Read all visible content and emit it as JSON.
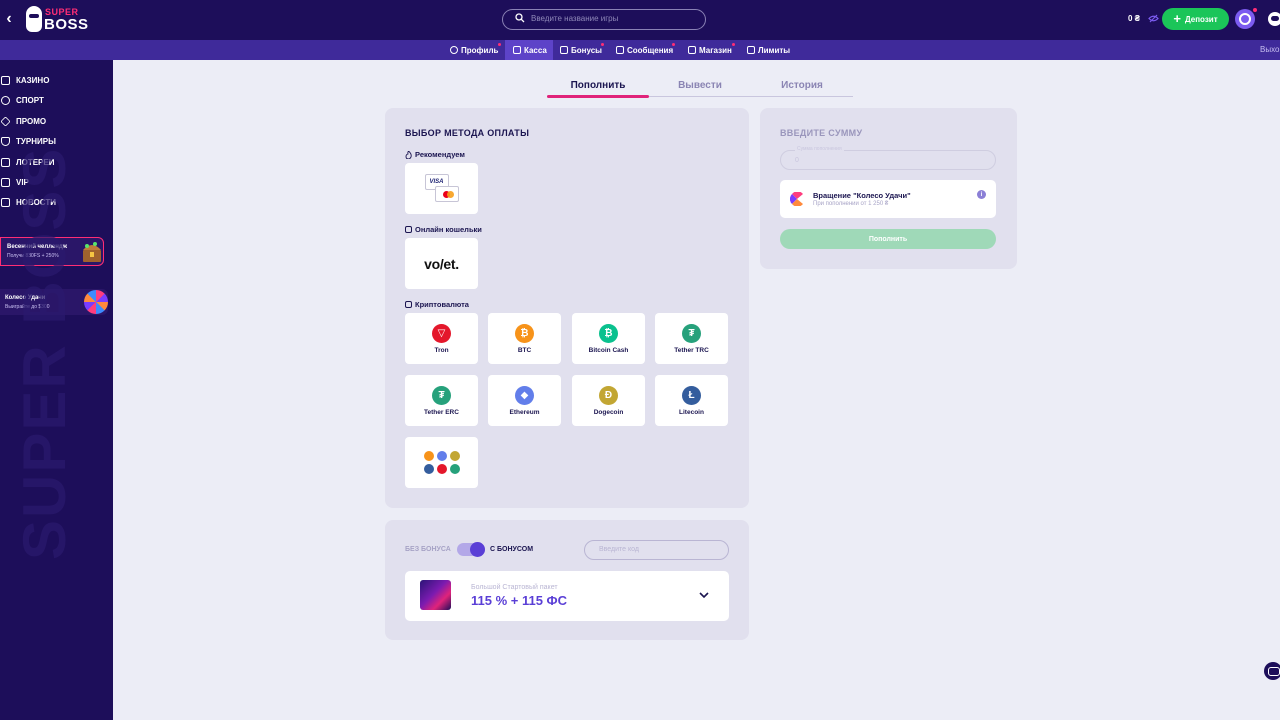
{
  "header": {
    "logo_top": "SUPER",
    "logo_bottom": "BOSS",
    "search_placeholder": "Введите название игры",
    "balance": "0 ₴",
    "deposit_label": "Депозит"
  },
  "subnav": {
    "items": [
      {
        "label": "Профиль",
        "icon": "user-icon"
      },
      {
        "label": "Касса",
        "icon": "wallet-icon",
        "active": true
      },
      {
        "label": "Бонусы",
        "icon": "gift-icon"
      },
      {
        "label": "Сообщения",
        "icon": "message-icon"
      },
      {
        "label": "Магазин",
        "icon": "shop-icon"
      },
      {
        "label": "Лимиты",
        "icon": "sliders-icon"
      }
    ],
    "logout": "Выхо"
  },
  "sidebar": {
    "items": [
      {
        "label": "КАЗИНО",
        "icon": "casino-icon"
      },
      {
        "label": "СПОРТ",
        "icon": "sport-icon"
      },
      {
        "label": "ПРОМО",
        "icon": "diamond-icon"
      },
      {
        "label": "ТУРНИРЫ",
        "icon": "trophy-icon"
      },
      {
        "label": "ЛОТЕРЕИ",
        "icon": "ticket-icon"
      },
      {
        "label": "VIP",
        "icon": "crown-icon"
      },
      {
        "label": "НОВОСТИ",
        "icon": "news-icon"
      }
    ],
    "promo1": {
      "title": "Весенний челлендж",
      "subtitle": "Получи 830FS + 250%"
    },
    "promo2": {
      "title": "Колесо Удачи",
      "subtitle": "Выиграйте до $300"
    },
    "bg_text": "SUPER BOSS"
  },
  "tabs": [
    {
      "label": "Пополнить",
      "active": true
    },
    {
      "label": "Вывести"
    },
    {
      "label": "История"
    }
  ],
  "methods": {
    "title": "ВЫБОР МЕТОДА ОПЛАТЫ",
    "sections": {
      "recommended": "Рекомендуем",
      "wallets": "Онлайн кошельки",
      "crypto": "Криптовалюта"
    },
    "visa_label": "VISA",
    "volet_label": "vo/et.",
    "crypto": [
      {
        "label": "Tron",
        "color": "#E4172B",
        "glyph": "▽"
      },
      {
        "label": "BTC",
        "color": "#F7931A",
        "glyph": "₿"
      },
      {
        "label": "Bitcoin Cash",
        "color": "#0AC18E",
        "glyph": "₿"
      },
      {
        "label": "Tether TRC",
        "color": "#26A17B",
        "glyph": "₮"
      },
      {
        "label": "Tether ERC",
        "color": "#26A17B",
        "glyph": "₮"
      },
      {
        "label": "Ethereum",
        "color": "#627EEA",
        "glyph": "◆"
      },
      {
        "label": "Dogecoin",
        "color": "#C2A633",
        "glyph": "Ð"
      },
      {
        "label": "Litecoin",
        "color": "#345D9D",
        "glyph": "Ł"
      }
    ]
  },
  "bonus": {
    "no_bonus": "БЕЗ БОНУСА",
    "with_bonus": "С БОНУСОМ",
    "code_placeholder": "Введите код",
    "package_name": "Большой Стартовый пакет",
    "package_value": "115 % + 115 ФС"
  },
  "amount": {
    "title": "ВВЕДИТЕ СУММУ",
    "field_label": "Сумма пополнения",
    "field_value": "0",
    "wheel_title": "Вращение \"Колесо Удачи\"",
    "wheel_sub": "При пополнении от 1 250 ₴",
    "pay_label": "Пополнить"
  },
  "colors": {
    "header_bg": "#1D0E5A",
    "subnav_bg": "#3F2A9A",
    "accent_pink": "#E0237A",
    "deposit_green": "#1BC559",
    "purple": "#5A3FD6"
  }
}
